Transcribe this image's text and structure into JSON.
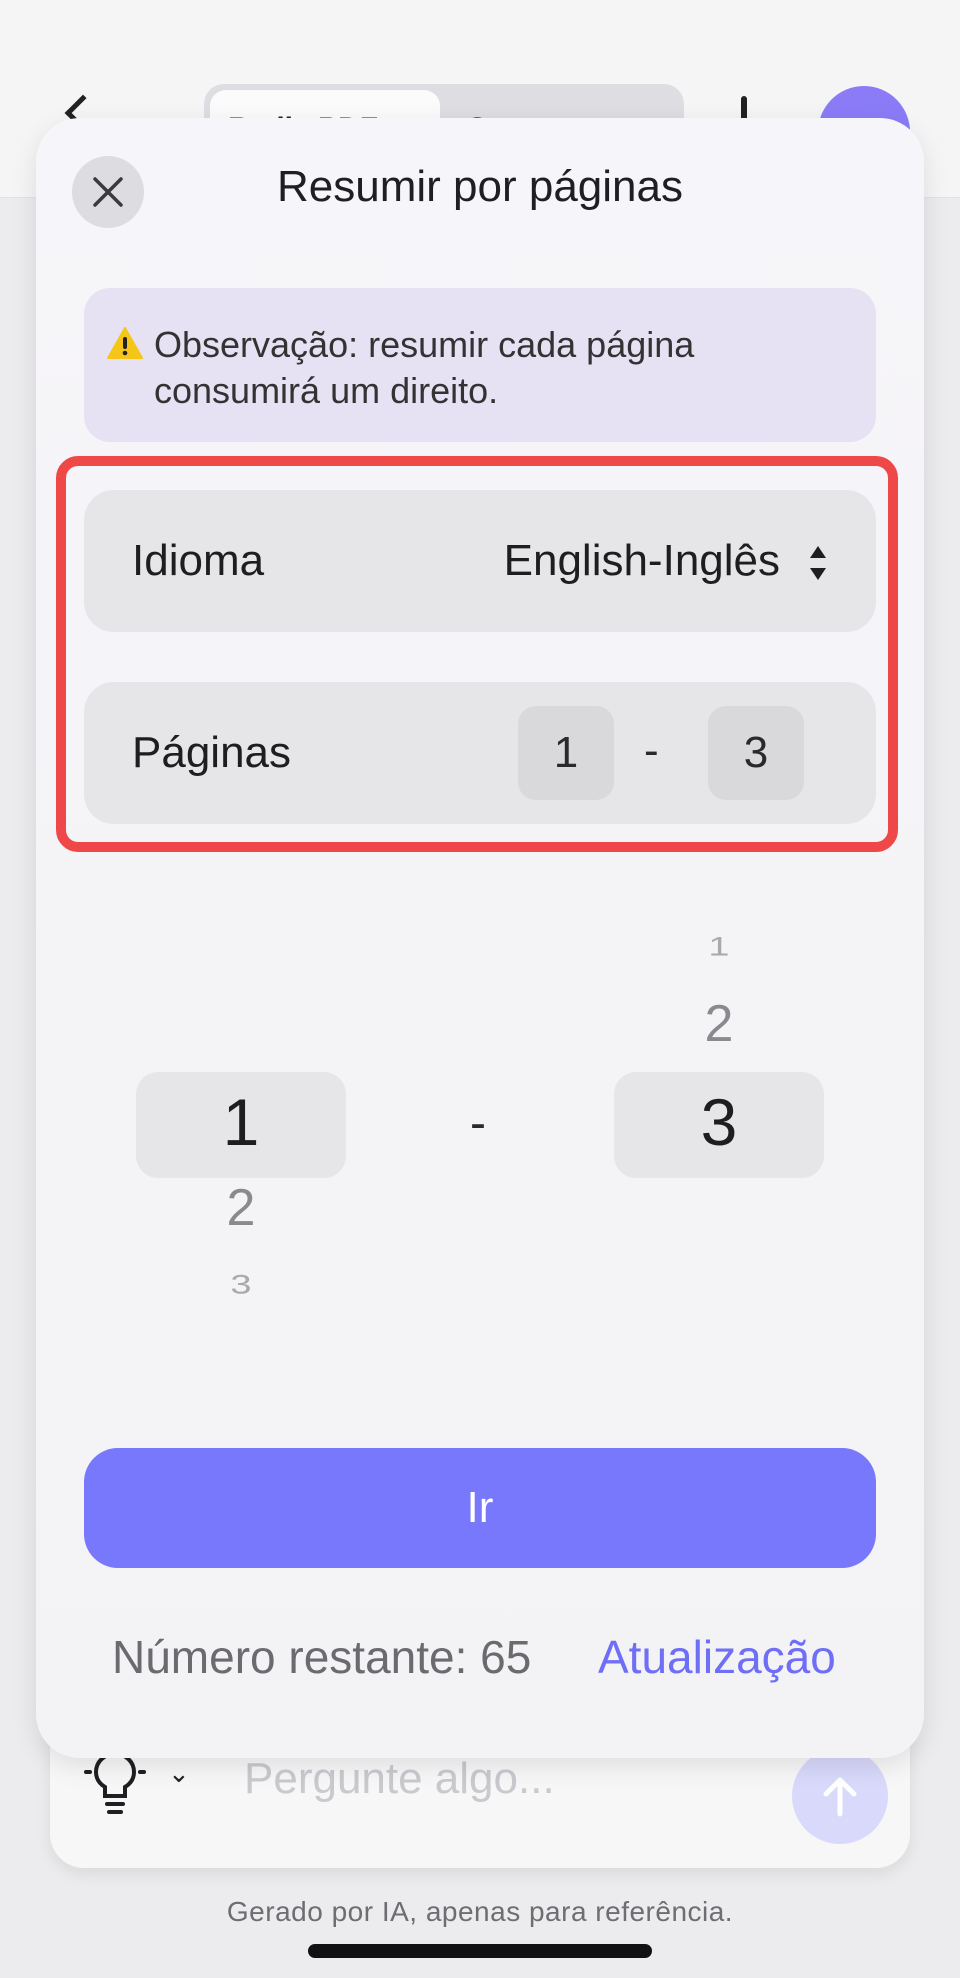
{
  "background": {
    "tab_active_label": "Radix PDF",
    "tab_second_label": "C",
    "ask_placeholder": "Pergunte algo...",
    "disclaimer": "Gerado por IA, apenas para referência."
  },
  "sheet": {
    "title": "Resumir por páginas",
    "notice": "Observação: resumir cada página consumirá um direito.",
    "language": {
      "label": "Idioma",
      "value": "English-Inglês"
    },
    "pages": {
      "label": "Páginas",
      "from": "1",
      "separator": "-",
      "to": "3"
    },
    "picker": {
      "from_selected": "1",
      "from_next": "2",
      "from_next2": "3",
      "separator": "-",
      "to_prev2": "1",
      "to_prev": "2",
      "to_selected": "3"
    },
    "go_label": "Ir",
    "remaining_label": "Número restante: 65",
    "upgrade_label": "Atualização"
  },
  "colors": {
    "accent": "#7778fc",
    "link": "#6e6ef6",
    "highlight": "#ef4848",
    "notice_bg": "#e7e1f4"
  },
  "icons": [
    "back-icon",
    "plus-icon",
    "avatar",
    "close-icon",
    "warning-icon",
    "updown-icon",
    "lightbulb-icon",
    "chevron-down-icon",
    "arrow-up-icon"
  ]
}
